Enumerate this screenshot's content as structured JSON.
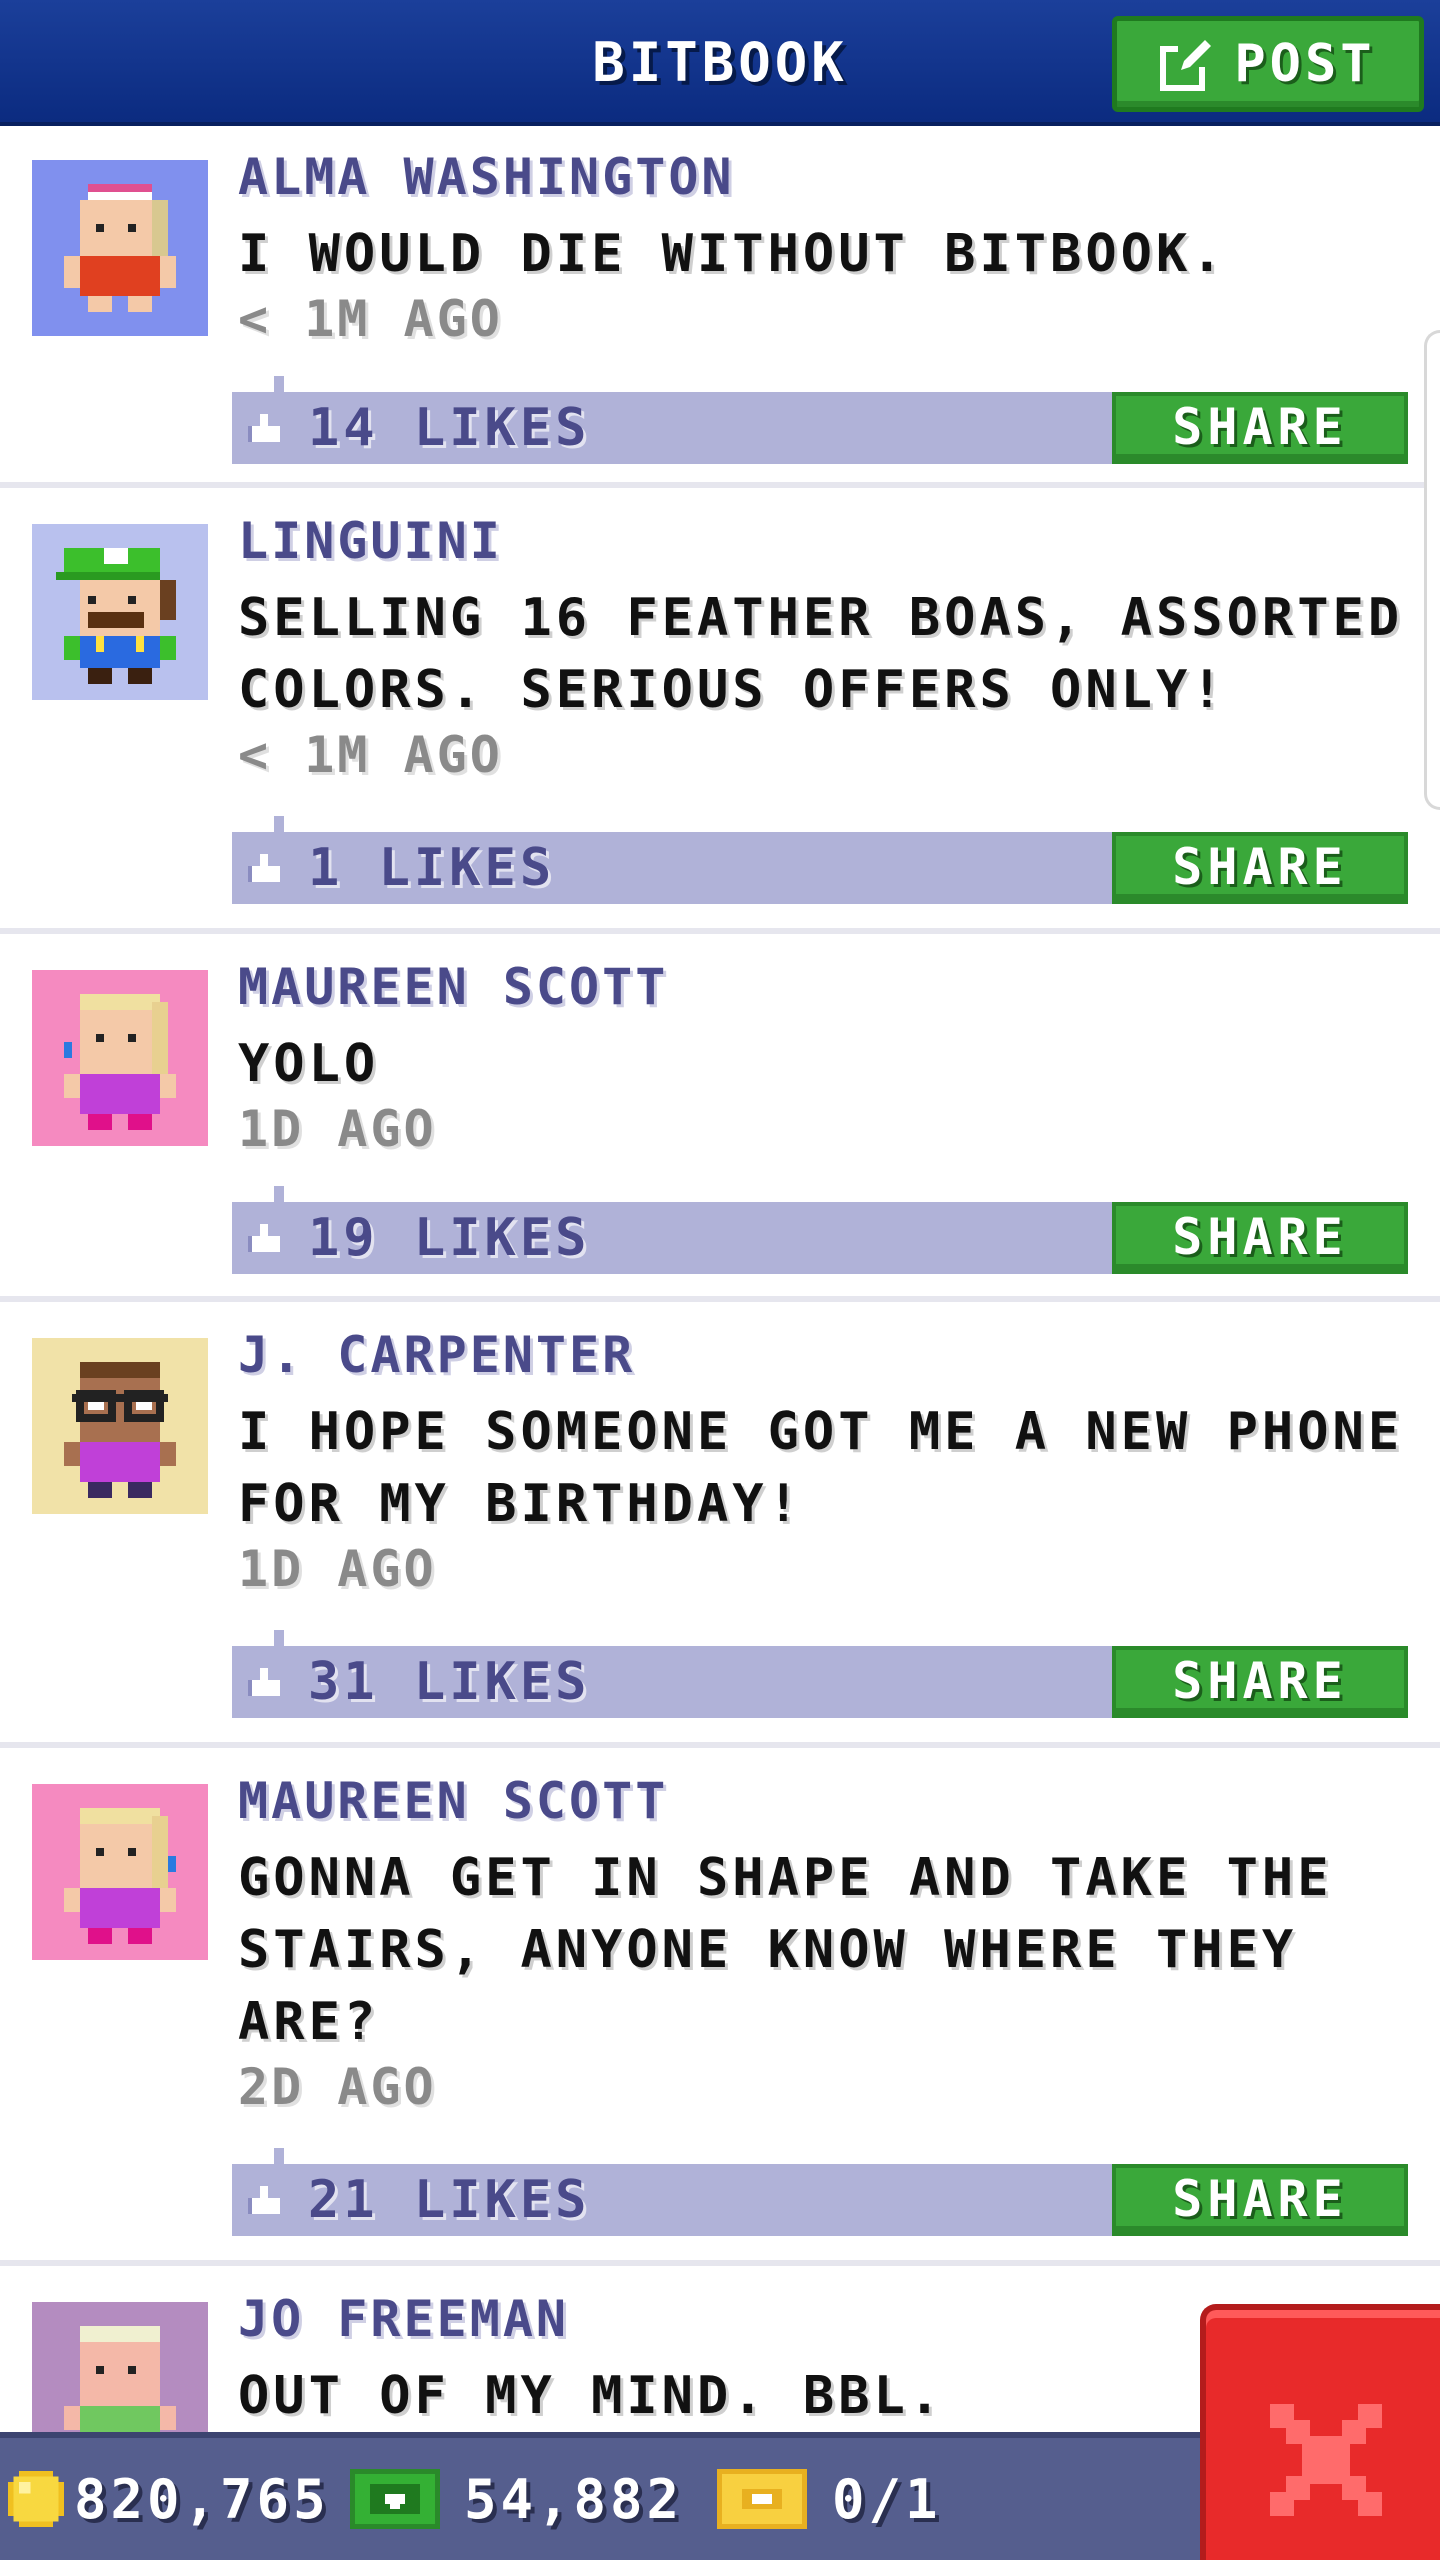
{
  "app": {
    "title": "BITBOOK",
    "post_label": "POST"
  },
  "colors": {
    "header_blue": "#0b2b80",
    "accent_green": "#3aa83a",
    "likes_bar": "#b0b2d8",
    "name_purple": "#4a4a8a",
    "close_red": "#e82a2a"
  },
  "feed": {
    "share_label": "SHARE",
    "posts": [
      {
        "author": "ALMA WASHINGTON",
        "message": "I WOULD DIE WITHOUT BITBOOK.",
        "time": "< 1M AGO",
        "likes": "14 LIKES",
        "avatar": "alma-washington-avatar"
      },
      {
        "author": "LINGUINI",
        "message": "SELLING 16 FEATHER BOAS, ASSORTED COLORS. SERIOUS OFFERS ONLY!",
        "time": "< 1M AGO",
        "likes": "1 LIKES",
        "avatar": "linguini-avatar"
      },
      {
        "author": "MAUREEN SCOTT",
        "message": "YOLO",
        "time": "1D AGO",
        "likes": "19 LIKES",
        "avatar": "maureen-scott-avatar"
      },
      {
        "author": "J. CARPENTER",
        "message": "I HOPE SOMEONE GOT ME A NEW PHONE FOR MY BIRTHDAY!",
        "time": "1D AGO",
        "likes": "31 LIKES",
        "avatar": "j-carpenter-avatar"
      },
      {
        "author": "MAUREEN SCOTT",
        "message": "GONNA GET IN SHAPE AND TAKE THE STAIRS, ANYONE KNOW WHERE THEY ARE?",
        "time": "2D AGO",
        "likes": "21 LIKES",
        "avatar": "maureen-scott-avatar"
      },
      {
        "author": "JO FREEMAN",
        "message": "OUT OF MY MIND. BBL.",
        "avatar": "jo-freeman-avatar"
      }
    ]
  },
  "footer": {
    "coins": "820,765",
    "bux": "54,882",
    "tickets": "0/1"
  }
}
